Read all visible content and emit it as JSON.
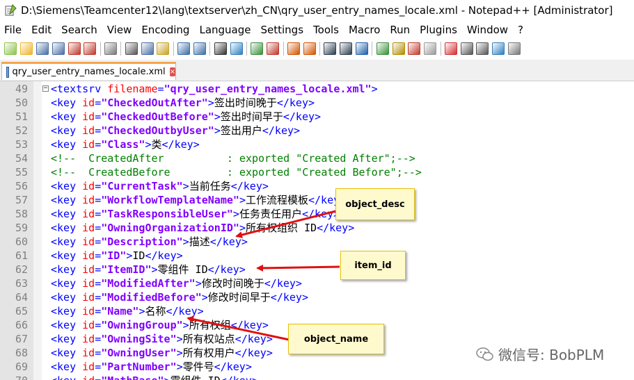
{
  "window": {
    "title": "D:\\Siemens\\Teamcenter12\\lang\\textserver\\zh_CN\\qry_user_entry_names_locale.xml - Notepad++ [Administrator]",
    "icon": "notepad-icon"
  },
  "menu": [
    "File",
    "Edit",
    "Search",
    "View",
    "Encoding",
    "Language",
    "Settings",
    "Tools",
    "Macro",
    "Run",
    "Plugins",
    "Window",
    "?"
  ],
  "toolbar": {
    "icons": [
      "new-file-icon",
      "open-file-icon",
      "save-icon",
      "save-all-icon",
      "close-icon",
      "close-all-icon",
      "print-icon",
      "cut-icon",
      "copy-icon",
      "paste-icon",
      "undo-icon",
      "redo-icon",
      "find-icon",
      "replace-icon",
      "zoom-in-icon",
      "zoom-out-icon",
      "sync-vertical-icon",
      "sync-horizontal-icon",
      "word-wrap-icon",
      "show-all-chars-icon",
      "indent-guide-icon",
      "doc-map-icon",
      "function-list-icon",
      "folder-workspace-icon",
      "monitoring-icon",
      "record-macro-icon",
      "stop-macro-icon",
      "play-macro-icon",
      "run-macro-multiple-icon",
      "save-macro-icon"
    ]
  },
  "tab": {
    "label": "qry_user_entry_names_locale.xml",
    "close": "×"
  },
  "lines": [
    {
      "n": "49",
      "fold": "⊟",
      "segs": [
        [
          "tag",
          "<textsrv "
        ],
        [
          "attr",
          "filename"
        ],
        [
          "tag",
          "="
        ],
        [
          "val",
          "\"qry_user_entry_names_locale.xml\""
        ],
        [
          "tag",
          ">"
        ]
      ]
    },
    {
      "n": "50",
      "segs": [
        [
          "tag",
          "<key "
        ],
        [
          "attr",
          "id"
        ],
        [
          "tag",
          "="
        ],
        [
          "val",
          "\"CheckedOutAfter\""
        ],
        [
          "tag",
          ">"
        ],
        [
          "text",
          "签出时间晚于"
        ],
        [
          "tag",
          "</key>"
        ]
      ]
    },
    {
      "n": "51",
      "segs": [
        [
          "tag",
          "<key "
        ],
        [
          "attr",
          "id"
        ],
        [
          "tag",
          "="
        ],
        [
          "val",
          "\"CheckedOutBefore\""
        ],
        [
          "tag",
          ">"
        ],
        [
          "text",
          "签出时间早于"
        ],
        [
          "tag",
          "</key>"
        ]
      ]
    },
    {
      "n": "52",
      "segs": [
        [
          "tag",
          "<key "
        ],
        [
          "attr",
          "id"
        ],
        [
          "tag",
          "="
        ],
        [
          "val",
          "\"CheckedOutbyUser\""
        ],
        [
          "tag",
          ">"
        ],
        [
          "text",
          "签出用户"
        ],
        [
          "tag",
          "</key>"
        ]
      ]
    },
    {
      "n": "53",
      "segs": [
        [
          "tag",
          "<key "
        ],
        [
          "attr",
          "id"
        ],
        [
          "tag",
          "="
        ],
        [
          "val",
          "\"Class\""
        ],
        [
          "tag",
          ">"
        ],
        [
          "text",
          "类"
        ],
        [
          "tag",
          "</key>"
        ]
      ]
    },
    {
      "n": "54",
      "segs": [
        [
          "comment",
          "<!--  CreatedAfter          : exported \"Created After\";-->"
        ]
      ]
    },
    {
      "n": "55",
      "segs": [
        [
          "comment",
          "<!--  CreatedBefore         : exported \"Created Before\";-->"
        ]
      ]
    },
    {
      "n": "56",
      "segs": [
        [
          "tag",
          "<key "
        ],
        [
          "attr",
          "id"
        ],
        [
          "tag",
          "="
        ],
        [
          "val",
          "\"CurrentTask\""
        ],
        [
          "tag",
          ">"
        ],
        [
          "text",
          "当前任务"
        ],
        [
          "tag",
          "</key>"
        ]
      ]
    },
    {
      "n": "57",
      "segs": [
        [
          "tag",
          "<key "
        ],
        [
          "attr",
          "id"
        ],
        [
          "tag",
          "="
        ],
        [
          "val",
          "\"WorkflowTemplateName\""
        ],
        [
          "tag",
          ">"
        ],
        [
          "text",
          "工作流程模板"
        ],
        [
          "tag",
          "</key>"
        ]
      ]
    },
    {
      "n": "58",
      "segs": [
        [
          "tag",
          "<key "
        ],
        [
          "attr",
          "id"
        ],
        [
          "tag",
          "="
        ],
        [
          "val",
          "\"TaskResponsibleUser\""
        ],
        [
          "tag",
          ">"
        ],
        [
          "text",
          "任务责任用户"
        ],
        [
          "tag",
          "</key>"
        ]
      ]
    },
    {
      "n": "59",
      "segs": [
        [
          "tag",
          "<key "
        ],
        [
          "attr",
          "id"
        ],
        [
          "tag",
          "="
        ],
        [
          "val",
          "\"OwningOrganizationID\""
        ],
        [
          "tag",
          ">"
        ],
        [
          "text",
          "所有权组织 ID"
        ],
        [
          "tag",
          "</key>"
        ]
      ]
    },
    {
      "n": "60",
      "segs": [
        [
          "tag",
          "<key "
        ],
        [
          "attr",
          "id"
        ],
        [
          "tag",
          "="
        ],
        [
          "val",
          "\"Description\""
        ],
        [
          "tag",
          ">"
        ],
        [
          "text",
          "描述"
        ],
        [
          "tag",
          "</key>"
        ]
      ]
    },
    {
      "n": "61",
      "segs": [
        [
          "tag",
          "<key "
        ],
        [
          "attr",
          "id"
        ],
        [
          "tag",
          "="
        ],
        [
          "val",
          "\"ID\""
        ],
        [
          "tag",
          ">"
        ],
        [
          "text",
          "ID"
        ],
        [
          "tag",
          "</key>"
        ]
      ]
    },
    {
      "n": "62",
      "segs": [
        [
          "tag",
          "<key "
        ],
        [
          "attr",
          "id"
        ],
        [
          "tag",
          "="
        ],
        [
          "val",
          "\"ItemID\""
        ],
        [
          "tag",
          ">"
        ],
        [
          "text",
          "零组件 ID"
        ],
        [
          "tag",
          "</key>"
        ]
      ]
    },
    {
      "n": "63",
      "segs": [
        [
          "tag",
          "<key "
        ],
        [
          "attr",
          "id"
        ],
        [
          "tag",
          "="
        ],
        [
          "val",
          "\"ModifiedAfter\""
        ],
        [
          "tag",
          ">"
        ],
        [
          "text",
          "修改时间晚于"
        ],
        [
          "tag",
          "</key>"
        ]
      ]
    },
    {
      "n": "64",
      "segs": [
        [
          "tag",
          "<key "
        ],
        [
          "attr",
          "id"
        ],
        [
          "tag",
          "="
        ],
        [
          "val",
          "\"ModifiedBefore\""
        ],
        [
          "tag",
          ">"
        ],
        [
          "text",
          "修改时间早于"
        ],
        [
          "tag",
          "</key>"
        ]
      ]
    },
    {
      "n": "65",
      "segs": [
        [
          "tag",
          "<key "
        ],
        [
          "attr",
          "id"
        ],
        [
          "tag",
          "="
        ],
        [
          "val",
          "\"Name\""
        ],
        [
          "tag",
          ">"
        ],
        [
          "text",
          "名称"
        ],
        [
          "tag",
          "</key>"
        ]
      ]
    },
    {
      "n": "66",
      "segs": [
        [
          "tag",
          "<key "
        ],
        [
          "attr",
          "id"
        ],
        [
          "tag",
          "="
        ],
        [
          "val",
          "\"OwningGroup\""
        ],
        [
          "tag",
          ">"
        ],
        [
          "text",
          "所有权组"
        ],
        [
          "tag",
          "</key>"
        ]
      ]
    },
    {
      "n": "67",
      "segs": [
        [
          "tag",
          "<key "
        ],
        [
          "attr",
          "id"
        ],
        [
          "tag",
          "="
        ],
        [
          "val",
          "\"OwningSite\""
        ],
        [
          "tag",
          ">"
        ],
        [
          "text",
          "所有权站点"
        ],
        [
          "tag",
          "</key>"
        ]
      ]
    },
    {
      "n": "68",
      "segs": [
        [
          "tag",
          "<key "
        ],
        [
          "attr",
          "id"
        ],
        [
          "tag",
          "="
        ],
        [
          "val",
          "\"OwningUser\""
        ],
        [
          "tag",
          ">"
        ],
        [
          "text",
          "所有权用户"
        ],
        [
          "tag",
          "</key>"
        ]
      ]
    },
    {
      "n": "69",
      "segs": [
        [
          "tag",
          "<key "
        ],
        [
          "attr",
          "id"
        ],
        [
          "tag",
          "="
        ],
        [
          "val",
          "\"PartNumber\""
        ],
        [
          "tag",
          ">"
        ],
        [
          "text",
          "零件号"
        ],
        [
          "tag",
          "</key>"
        ]
      ]
    },
    {
      "n": "70",
      "segs": [
        [
          "tag",
          "<key "
        ],
        [
          "attr",
          "id"
        ],
        [
          "tag",
          "="
        ],
        [
          "val",
          "\"MathBase\""
        ],
        [
          "tag",
          ">"
        ],
        [
          "text",
          "零组件 ID"
        ],
        [
          "tag",
          "</key>"
        ]
      ]
    }
  ],
  "annotations": {
    "object_desc": "object_desc",
    "item_id": "item_id",
    "object_name": "object_name"
  },
  "watermark": {
    "text": "微信号: BobPLM",
    "icon": "wechat-icon"
  },
  "colors": {
    "tag": "#0000ff",
    "attr": "#ff0000",
    "value": "#8000ff",
    "comment": "#008000",
    "arrow": "#e01010",
    "tab_accent": "#f5a44a",
    "annotation_bg": "#fffacd"
  }
}
